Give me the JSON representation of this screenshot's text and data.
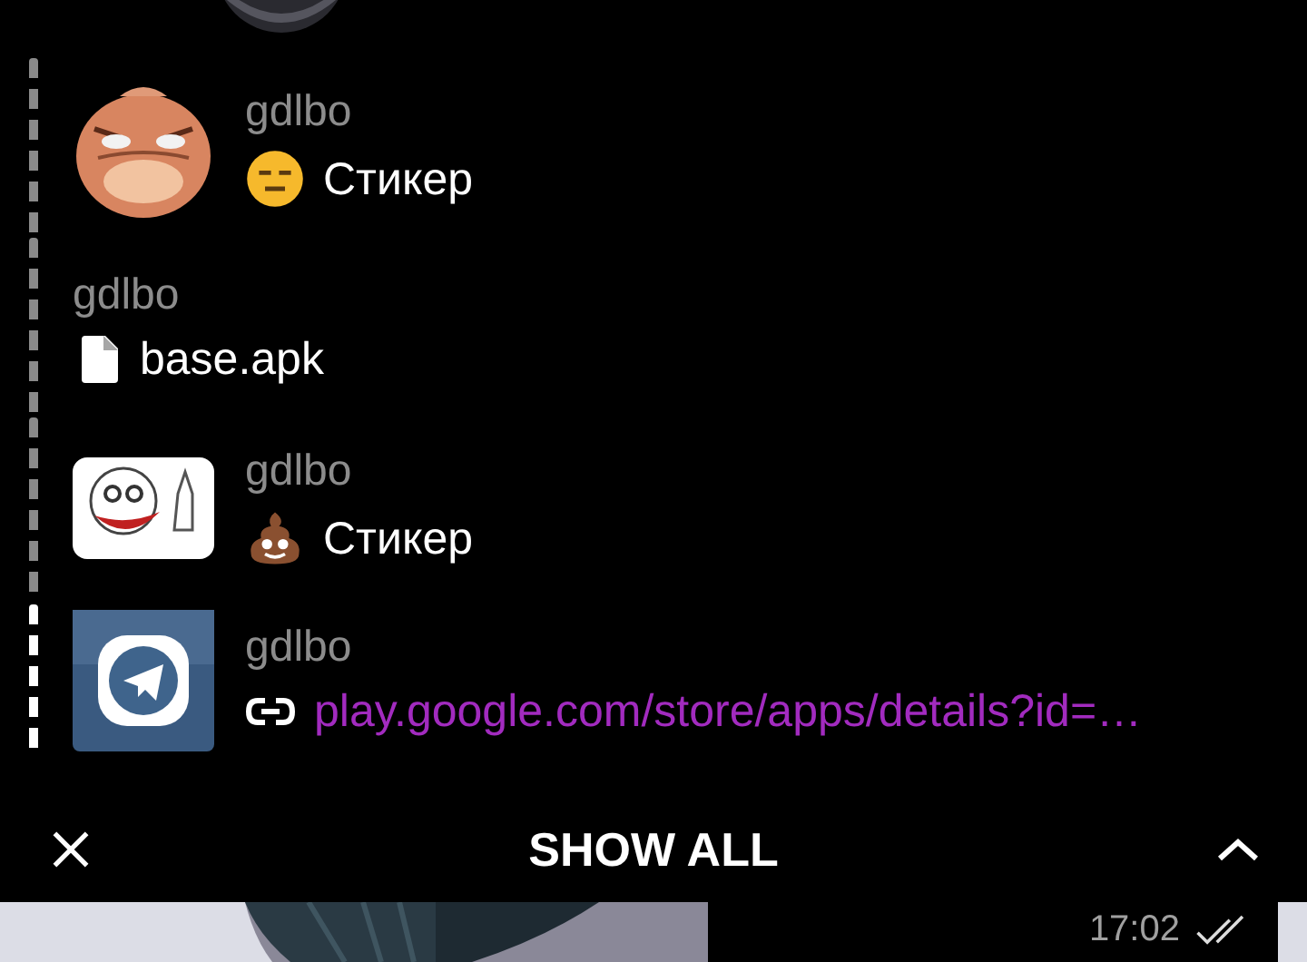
{
  "pinned_messages": [
    {
      "kind": "sticker",
      "sender": "gdlbo",
      "text": "Стикер",
      "selected": false
    },
    {
      "kind": "file",
      "sender": "gdlbo",
      "text": "base.apk",
      "selected": false
    },
    {
      "kind": "sticker",
      "sender": "gdlbo",
      "text": "Стикер",
      "selected": false
    },
    {
      "kind": "link",
      "sender": "gdlbo",
      "text": "play.google.com/store/apps/details?id=…",
      "selected": true
    }
  ],
  "bottom_bar": {
    "label": "SHOW ALL"
  },
  "message": {
    "time": "17:02",
    "read": true
  }
}
